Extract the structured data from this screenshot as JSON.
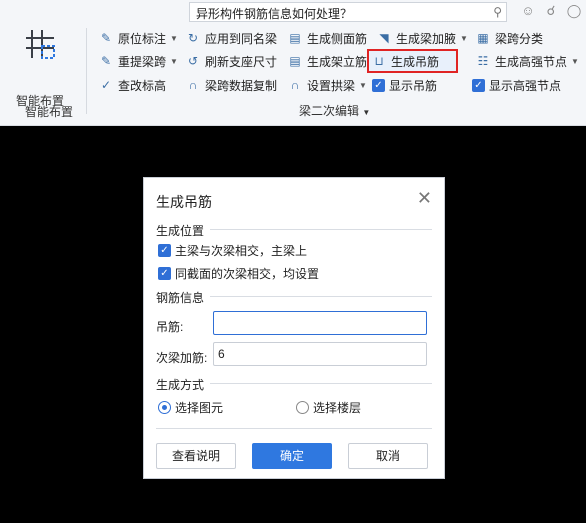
{
  "search": {
    "text": "异形构件钢筋信息如何处理？"
  },
  "topbar": {
    "icons": [
      "search-icon",
      "account-icon",
      "headset-icon",
      "chat-icon"
    ]
  },
  "ribbon": {
    "smart_layout_label": "智能布置",
    "smart_layout_group": "智能布置",
    "group_label": "梁二次编辑",
    "tools": {
      "yuanwei": "原位标注",
      "apply_same": "应用到同名梁",
      "side_rebar": "生成侧面筋",
      "haunch": "生成梁加腋",
      "span_split": "梁跨分类",
      "re_extract": "重提梁跨",
      "refresh_support": "刷新支座尺寸",
      "erect_rebar": "生成架立筋",
      "hanger": "生成吊筋",
      "high_node": "生成高强节点",
      "check_elev": "查改标高",
      "span_copy": "梁跨数据复制",
      "arch_rebar": "设置拱梁",
      "show_hanger": "显示吊筋",
      "show_high_node": "显示高强节点"
    }
  },
  "dialog": {
    "title": "生成吊筋",
    "section_position": "生成位置",
    "check1": "主梁与次梁相交，主梁上",
    "check2": "同截面的次梁相交，均设置",
    "section_rebar": "钢筋信息",
    "label_hanger": "吊筋:",
    "value_hanger": "",
    "label_secondary": "次梁加筋:",
    "value_secondary": "6",
    "section_method": "生成方式",
    "radio1": "选择图元",
    "radio2": "选择楼层",
    "btn_help": "查看说明",
    "btn_ok": "确定",
    "btn_cancel": "取消"
  }
}
